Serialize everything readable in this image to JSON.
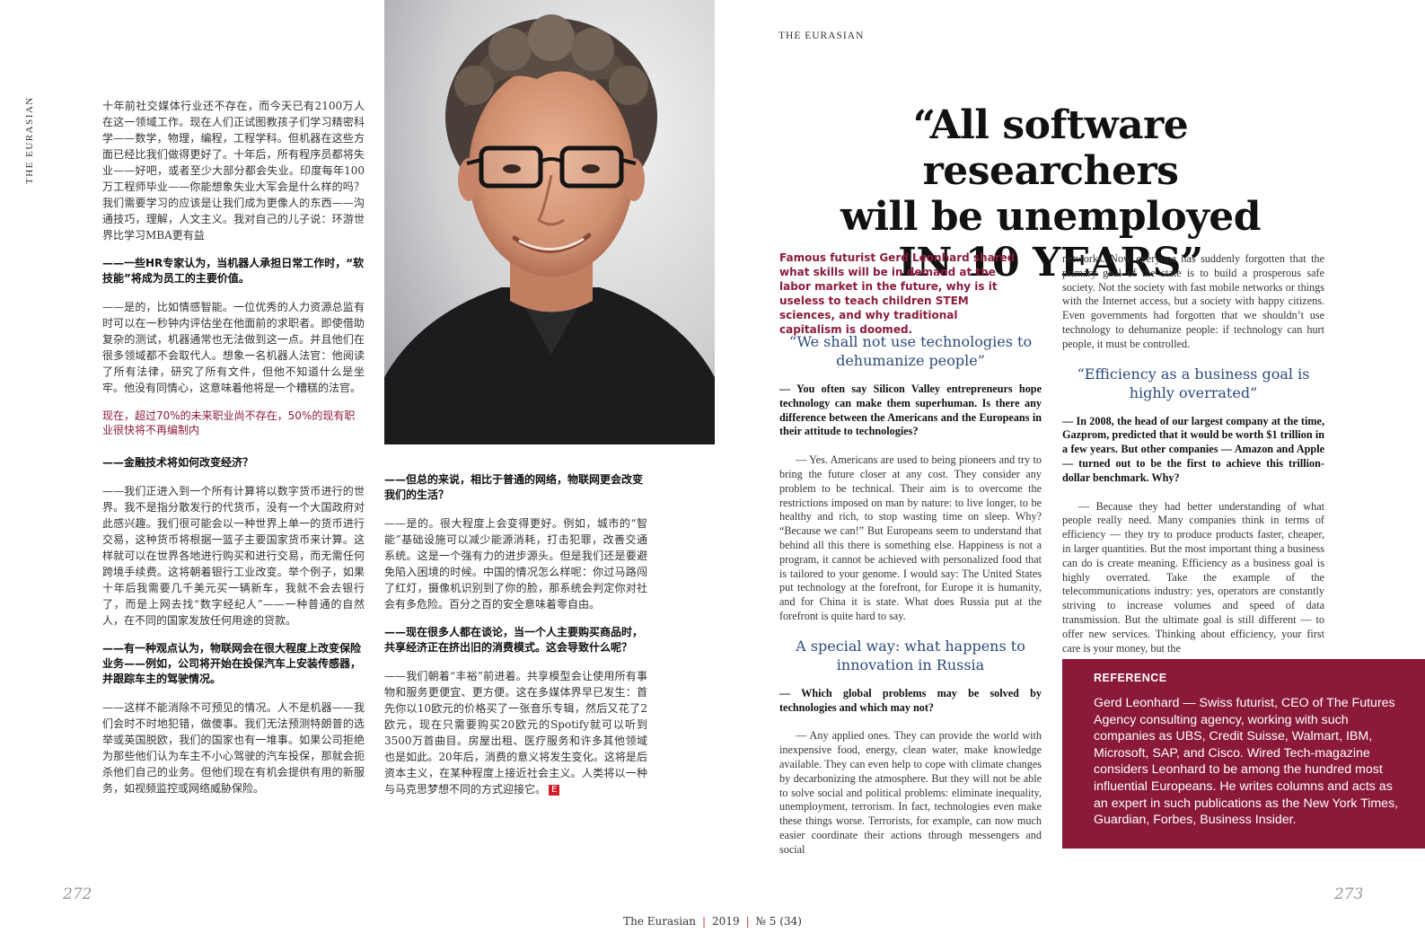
{
  "vertical_label": "THE EURASIAN",
  "top_right_label": "THE EURASIAN",
  "headline": {
    "line1": "“All software researchers",
    "line2": "will be unemployed",
    "line3": "IN 10 YEARS”"
  },
  "lead": "Famous futurist Gerd Leonhard shared what skills will be in demand at the labor market in the future, why is it useless to teach children STEM sciences, and why traditional capitalism is doomed.",
  "zh_left": {
    "p1": "十年前社交媒体行业还不存在，而今天已有2100万人在这一领域工作。现在人们正试图教孩子们学习精密科学——数学，物理，编程，工程学科。但机器在这些方面已经比我们做得更好了。十年后，所有程序员都将失业——好吧，或者至少大部分都会失业。印度每年100万工程师毕业——你能想象失业大军会是什么样的吗？我们需要学习的应该是让我们成为更像人的东西——沟通技巧，理解，人文主义。我对自己的儿子说：环游世界比学习MBA更有益",
    "q1": "——一些HR专家认为，当机器人承担日常工作时，“软技能”将成为员工的主要价值。",
    "p2": "——是的，比如情感智能。一位优秀的人力资源总监有时可以在一秒钟内评估坐在他面前的求职者。即使借助复杂的测试，机器通常也无法做到这一点。并且他们在很多领域都不会取代人。想象一名机器人法官：他阅读了所有法律，研究了所有文件，但他不知道什么是坐牢。他没有同情心，这意味着他将是一个糟糕的法官。",
    "pull": "现在，超过70%的未来职业尚不存在，50%的现有职业很快将不再编制内",
    "q2": "——金融技术将如何改变经济？",
    "p3": "——我们正进入到一个所有计算将以数字货币进行的世界。我不是指分散发行的代货币，没有一个大国政府对此感兴趣。我们很可能会以一种世界上单一的货币进行交易，这种货币将根据一篮子主要国家货币来计算。这样就可以在世界各地进行购买和进行交易，而无需任何跨境手续费。这将朝着银行工业改变。举个例子，如果十年后我需要几千美元买一辆新车，我就不会去银行了，而是上网去找“数字经纪人”——一种普通的自然人，在不同的国家发放任何用途的贷款。",
    "q3": "——有一种观点认为，物联网会在很大程度上改变保险业务——例如，公司将开始在投保汽车上安装传感器，并跟踪车主的驾驶情况。",
    "p4": "——这样不能消除不可预见的情况。人不是机器——我们会时不时地犯错，做傻事。我们无法预测特朗普的选举或英国脱欧，我们的国家也有一堆事。如果公司拒绝为那些他们认为车主不小心驾驶的汽车投保，那就会扼杀他们自己的业务。但他们现在有机会提供有用的新服务，如视频监控或网络威胁保险。"
  },
  "zh_mid": {
    "q1": "——但总的来说，相比于普通的网络，物联网更会改变我们的生活？",
    "p1": "——是的。很大程度上会变得更好。例如，城市的“智能”基础设施可以减少能源消耗，打击犯罪，改善交通系统。这是一个强有力的进步源头。但是我们还是要避免陷入困境的时候。中国的情况怎么样呢：你过马路闯了红灯，摄像机识别到了你的脸，那系统会判定你对社会有多危险。百分之百的安全意味着零自由。",
    "q2": "——现在很多人都在谈论，当一个人主要购买商品时，共享经济正在挤出旧的消费模式。这会导致什么呢？",
    "p2": "——我们朝着“丰裕”前进着。共享模型会让使用所有事物和服务更便宜、更方便。这在多媒体界早已发生：首先你以10欧元的价格买了一张音乐专辑，然后又花了2欧元，现在只需要购买20欧元的Spotify就可以听到3500万首曲目。房屋出租、医疗服务和许多其他领域也是如此。20年后，消费的意义将发生变化。这将是后资本主义，在某种程度上接近社会主义。人类将以一种与马克思梦想不同的方式迎接它。",
    "end_mark": "E"
  },
  "en_col1": {
    "sub1": "“We shall not use technologies to dehumanize people”",
    "q1": "— You often say Silicon Valley entrepreneurs hope technology can make them superhuman. Is there any difference between the Americans and the Europeans in their attitude to technologies?",
    "p1": "— Yes. Americans are used to being pioneers and try to bring the future closer at any cost. They consider any problem to be technical. Their aim is to overcome the restrictions imposed on man by nature: to live longer, to be healthy and rich, to stop wasting time on sleep. Why? “Because we can!” But Europeans seem to understand that behind all this there is something else. Happiness is not a program, it cannot be achieved with personalized food that is tailored to your genome. I would say: The United States put technology at the forefront, for Europe it is humanity, and for China it is state. What does Russia put at the forefront is quite hard to say.",
    "sub2": "A special way: what happens to innovation in Russia",
    "q2": "— Which global problems may be solved by technologies and which may not?",
    "p2": "— Any applied ones. They can provide the world with inexpensive food, energy, clean water, make knowledge available. They can even help to cope with climate changes by decarbonizing the atmosphere. But they will not be able to solve social and political problems: eliminate inequality, unemployment, terrorism. In fact, technologies even make these things worse. Terrorists, for example, can now much easier coordinate their actions through messengers and social"
  },
  "en_col2": {
    "p0": "networks. Now everyone has suddenly forgotten that the primary goal of the state is to build a prosperous safe society. Not the society with fast mobile networks or things with the Internet access, but a society with happy citizens. Even governments had forgotten that we shouldn’t use technology to dehumanize people: if technology can hurt people, it must be controlled.",
    "sub1": "“Efficiency as a business goal is highly overrated”",
    "q1": "— In 2008, the head of our largest company at the time, Gazprom, predicted that it would be worth $1 trillion in a few years. But other companies — Amazon and Apple — turned out to be the first to achieve this trillion-dollar benchmark. Why?",
    "p1": "— Because they had better understanding of what people really need. Many companies think in terms of efficiency — they try to produce products faster, cheaper, in larger quantities. But the most important thing a business can do is create meaning. Efficiency as a business goal is highly overrated. Take the example of the telecommunications industry: yes, operators are constantly striving to increase volumes and speed of data transmission. But the ultimate goal is still different — to offer new services. Thinking about efficiency, your first care is your money, but the"
  },
  "reference": {
    "title": "REFERENCE",
    "body": "Gerd Leonhard — Swiss futurist, CEO of The Futures Agency consulting agency, working with such companies as UBS, Credit Suisse, Walmart, IBM, Microsoft, SAP, and Cisco. Wired Tech-magazine considers Leonhard to be among the hundred most influential Europeans. He writes columns and acts as an expert in such publications as the New York Times, Guardian, Forbes, Business Insider."
  },
  "page_left": "272",
  "page_right": "273",
  "footer": {
    "magazine": "The Eurasian",
    "year": "2019",
    "issue": "№ 5 (34)"
  },
  "colors": {
    "accent": "#8a1a38",
    "subhead": "#2b4a7a",
    "footer_sep": "#c0392b"
  }
}
